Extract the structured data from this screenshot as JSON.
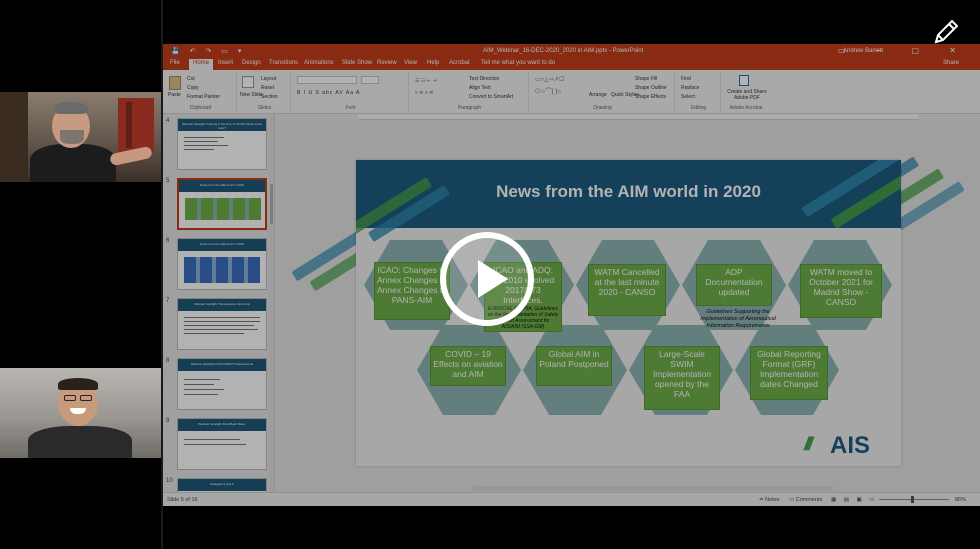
{
  "window": {
    "title": "AIM_Webinar_16-DEC-2020_2020 in AIM.pptx - PowerPoint",
    "user": "Andrew Barrett",
    "quick_access": "💾 ↶ ↷ ▭ ▾",
    "window_controls": "▭ ─ ▢ ✕",
    "share": "Share"
  },
  "tabs": [
    "File",
    "Home",
    "Insert",
    "Design",
    "Transitions",
    "Animations",
    "Slide Show",
    "Review",
    "View",
    "Help",
    "Acrobat",
    "Tell me what you want to do"
  ],
  "ribbon": {
    "paste": "Paste",
    "cut": "Cut",
    "copy": "Copy",
    "format_painter": "Format Painter",
    "clipboard": "Clipboard",
    "new_slide": "New Slide",
    "layout": "Layout",
    "reset": "Reset",
    "section": "Section",
    "slides": "Slides",
    "font": "Font",
    "font_styles": "B I U S abc AV Aa A",
    "paragraph": "Paragraph",
    "text_direction": "Text Direction",
    "align_text": "Align Text",
    "convert_smartart": "Convert to SmartArt",
    "drawing": "Drawing",
    "arrange": "Arrange",
    "quick_styles": "Quick Styles",
    "shape_fill": "Shape Fill",
    "shape_outline": "Shape Outline",
    "shape_effects": "Shape Effects",
    "find": "Find",
    "replace": "Replace",
    "select": "Select",
    "editing": "Editing",
    "create_share": "Create and Share Adobe PDF",
    "adobe": "Adobe Acrobat"
  },
  "thumbnails": [
    {
      "num": "4",
      "title": "Webinar Spotlight Training in the time of COVID What works best?"
    },
    {
      "num": "5",
      "title": "News from the AIM world in 2020"
    },
    {
      "num": "6",
      "title": "News from the AIM world in 2020"
    },
    {
      "num": "7",
      "title": "Webinar Spotlight Transmission First Look"
    },
    {
      "num": "8",
      "title": "Webinar Spotlight ICAO IMPACT Assessments"
    },
    {
      "num": "9",
      "title": "Webinar Spotlight Build Back Better"
    },
    {
      "num": "10",
      "title": "Delegate Q and A"
    }
  ],
  "slide": {
    "title": "News from the AIM world in 2020",
    "row1": [
      {
        "text": "ICAO: Changes to Annex Changes to Annex Changes to PANS-AIM",
        "sub": ""
      },
      {
        "text": "ICAO and ADQ: 73/2010 evolved 2017/373 Interfaces.",
        "sub": "EUROCAE ED-76A, Guidelines on the Implementation of Safety Support Assessment for AIS/AIM (SSA-GM)"
      },
      {
        "text": "WATM Cancelled at the last minute 2020 - CANSO",
        "sub": ""
      },
      {
        "text": "ADP Documentation updated",
        "sub": "Guidelines Supporting the Implementation of Aeronautical Information Requirements"
      },
      {
        "text": "WATM moved to October 2021 for Madrid Show - CANSO",
        "sub": ""
      }
    ],
    "row2": [
      {
        "text": "COVID – 19 Effects on aviation and AIM"
      },
      {
        "text": "Global AIM in Poland Postponed"
      },
      {
        "text": "Large-Scale SWIM Implementation opened by the FAA"
      },
      {
        "text": "Global Reporting Format (GRF) Implementation dates Changed"
      }
    ],
    "logo_bars": "///",
    "logo_text": "AIS"
  },
  "status": {
    "slide_info": "Slide 5 of 16",
    "notes": "≐ Notes",
    "comments": "▭ Comments",
    "zoom": "86%",
    "views": "▦ ▤ ▣ ▭"
  },
  "colors": {
    "accent": "#c43e1c",
    "slide_header": "#1e5d80",
    "box_green": "#6fb04a",
    "hex_teal": "#8fb6b3"
  }
}
